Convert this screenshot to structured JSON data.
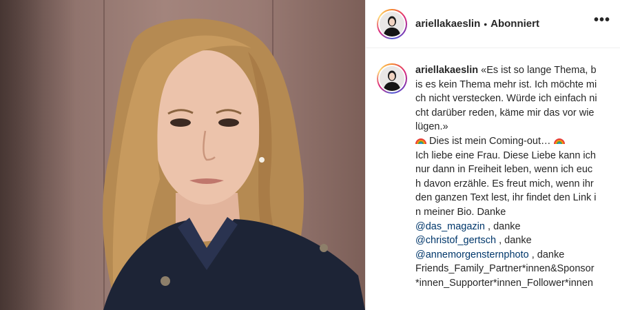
{
  "header": {
    "username": "ariellakaeslin",
    "separator": "•",
    "follow_status": "Abonniert",
    "more_icon": "•••"
  },
  "caption": {
    "username": "ariellakaeslin",
    "quote": "«Es ist so lange Thema, bis es kein Thema mehr ist. Ich möchte mich nicht verstecken. Würde ich einfach nicht darüber reden, käme mir das vor wie lügen.»",
    "rainbow_icon": "rainbow-flag-icon",
    "coming_out": "Dies ist mein Coming-out…",
    "body": "Ich liebe eine Frau. Diese Liebe kann ich nur dann in Freiheit leben, wenn ich euch davon erzähle. Es freut mich, wenn ihr den ganzen Text lest, ihr findet den Link in meiner Bio. Danke",
    "mention_1": "@das_magazin",
    "sep_1": " , danke",
    "mention_2": "@christof_gertsch",
    "sep_2": " , danke",
    "mention_3": "@annemorgensternphoto",
    "sep_3": " , danke",
    "tail": "Friends_Family_Partner*innen&Sponsor*innen_Supporter*innen_Follower*innen"
  },
  "colors": {
    "text": "#262626",
    "mention": "#00376b",
    "divider": "#efefef"
  }
}
